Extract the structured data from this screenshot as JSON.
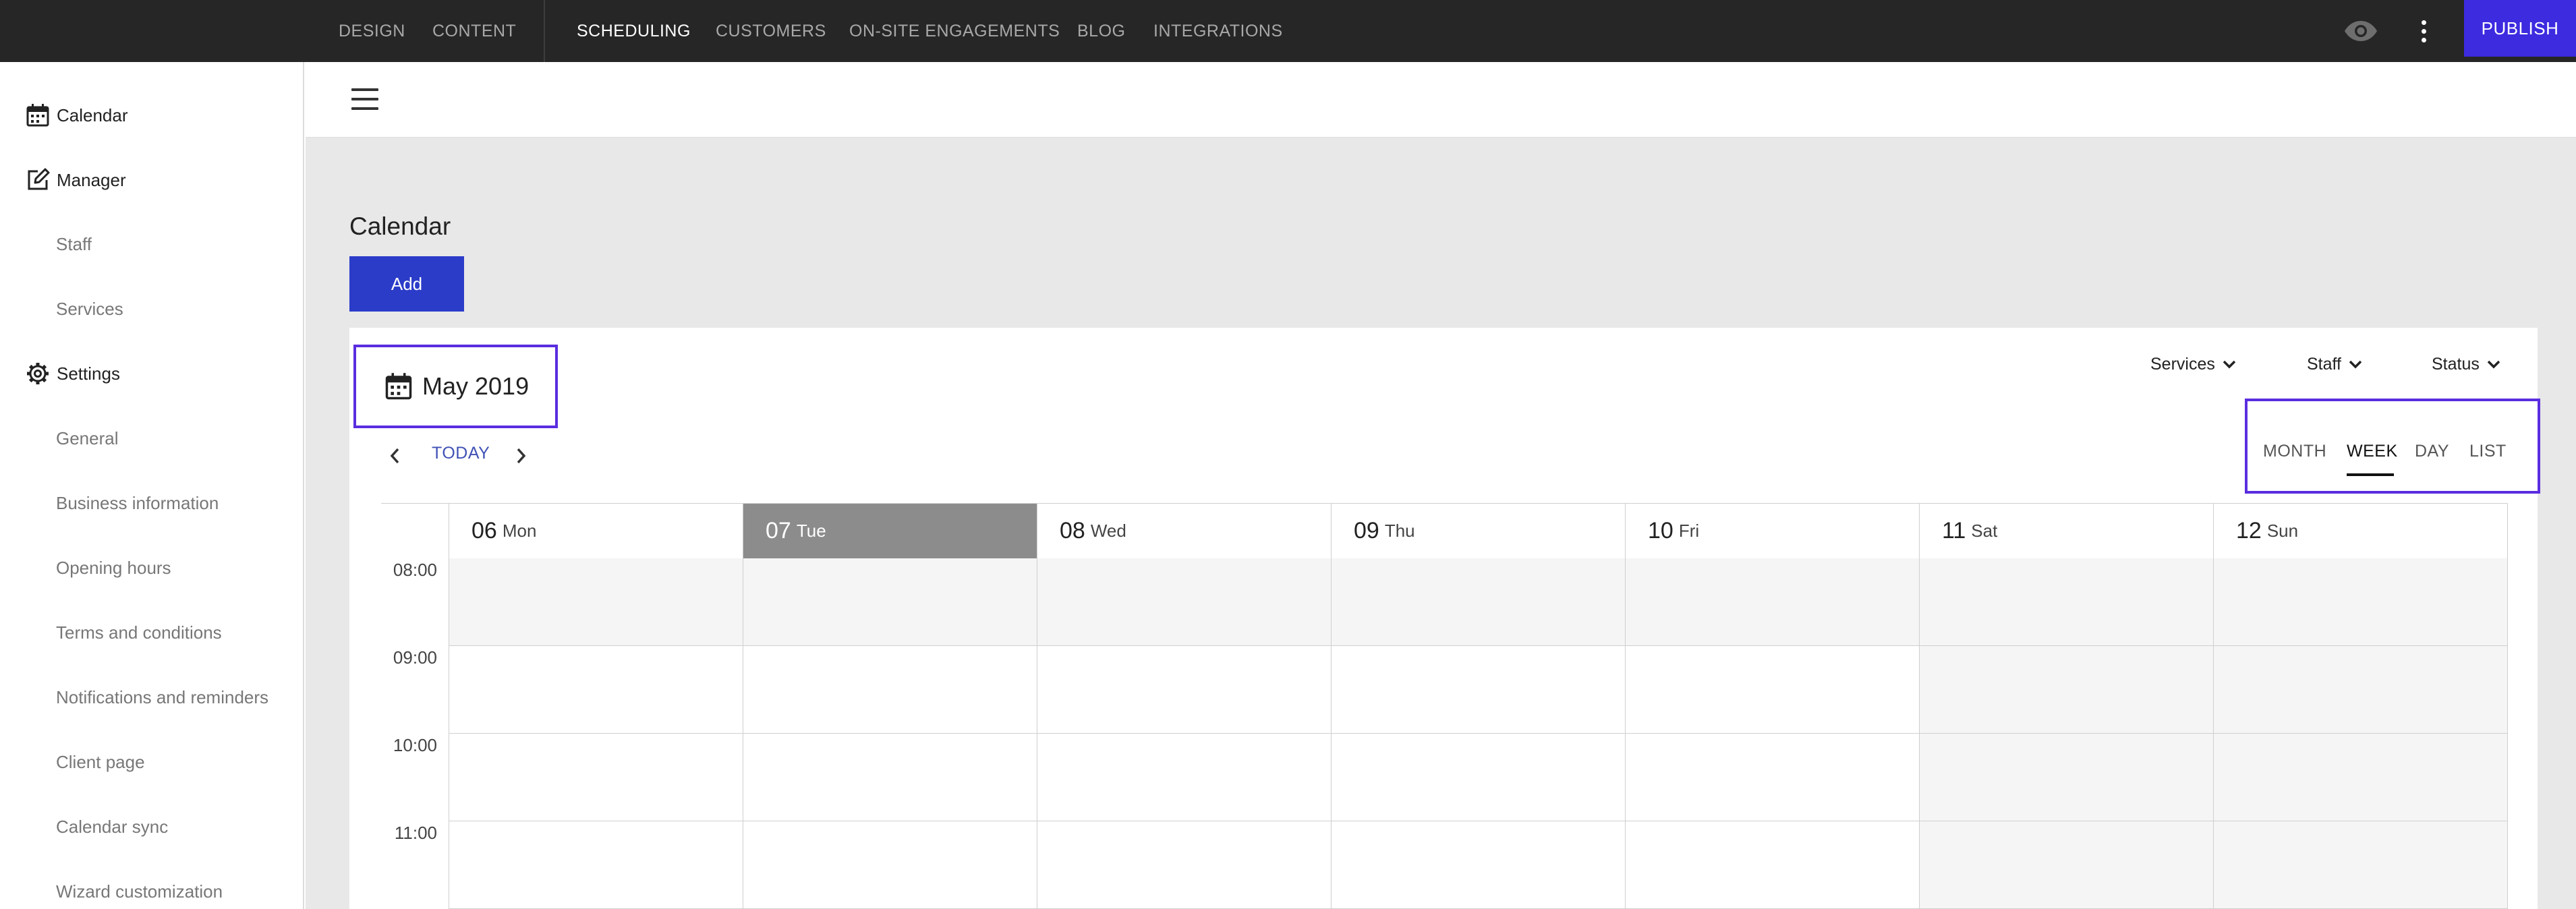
{
  "topbar": {
    "nav": [
      "DESIGN",
      "CONTENT",
      "SCHEDULING",
      "CUSTOMERS",
      "ON-SITE ENGAGEMENTS",
      "BLOG",
      "INTEGRATIONS"
    ],
    "active": "SCHEDULING",
    "publish_label": "PUBLISH",
    "preview_icon": "eye-icon",
    "more_icon": "more-vert-icon"
  },
  "sidebar": {
    "calendar_label": "Calendar",
    "manager_label": "Manager",
    "manager_items": [
      "Staff",
      "Services"
    ],
    "settings_label": "Settings",
    "settings_items": [
      "General",
      "Business information",
      "Opening hours",
      "Terms and conditions",
      "Notifications and reminders",
      "Client page",
      "Calendar sync",
      "Wizard customization"
    ]
  },
  "main": {
    "title": "Calendar",
    "add_label": "Add",
    "month_label": "May 2019",
    "today_label": "TODAY",
    "filters": [
      "Services",
      "Staff",
      "Status"
    ],
    "views": [
      "MONTH",
      "WEEK",
      "DAY",
      "LIST"
    ],
    "active_view": "WEEK"
  },
  "calendar": {
    "days": [
      {
        "num": "06",
        "name": "Mon"
      },
      {
        "num": "07",
        "name": "Tue"
      },
      {
        "num": "08",
        "name": "Wed"
      },
      {
        "num": "09",
        "name": "Thu"
      },
      {
        "num": "10",
        "name": "Fri"
      },
      {
        "num": "11",
        "name": "Sat"
      },
      {
        "num": "12",
        "name": "Sun"
      }
    ],
    "today_index": 1,
    "times": [
      "08:00",
      "09:00",
      "10:00",
      "11:00"
    ]
  },
  "colors": {
    "topbar_bg": "#262626",
    "publish_bg": "#3d2be0",
    "add_bg": "#2b3cc9",
    "highlight_border": "#5a2de0",
    "today_header_bg": "#8c8c8c",
    "link_blue": "#3f51b5"
  }
}
